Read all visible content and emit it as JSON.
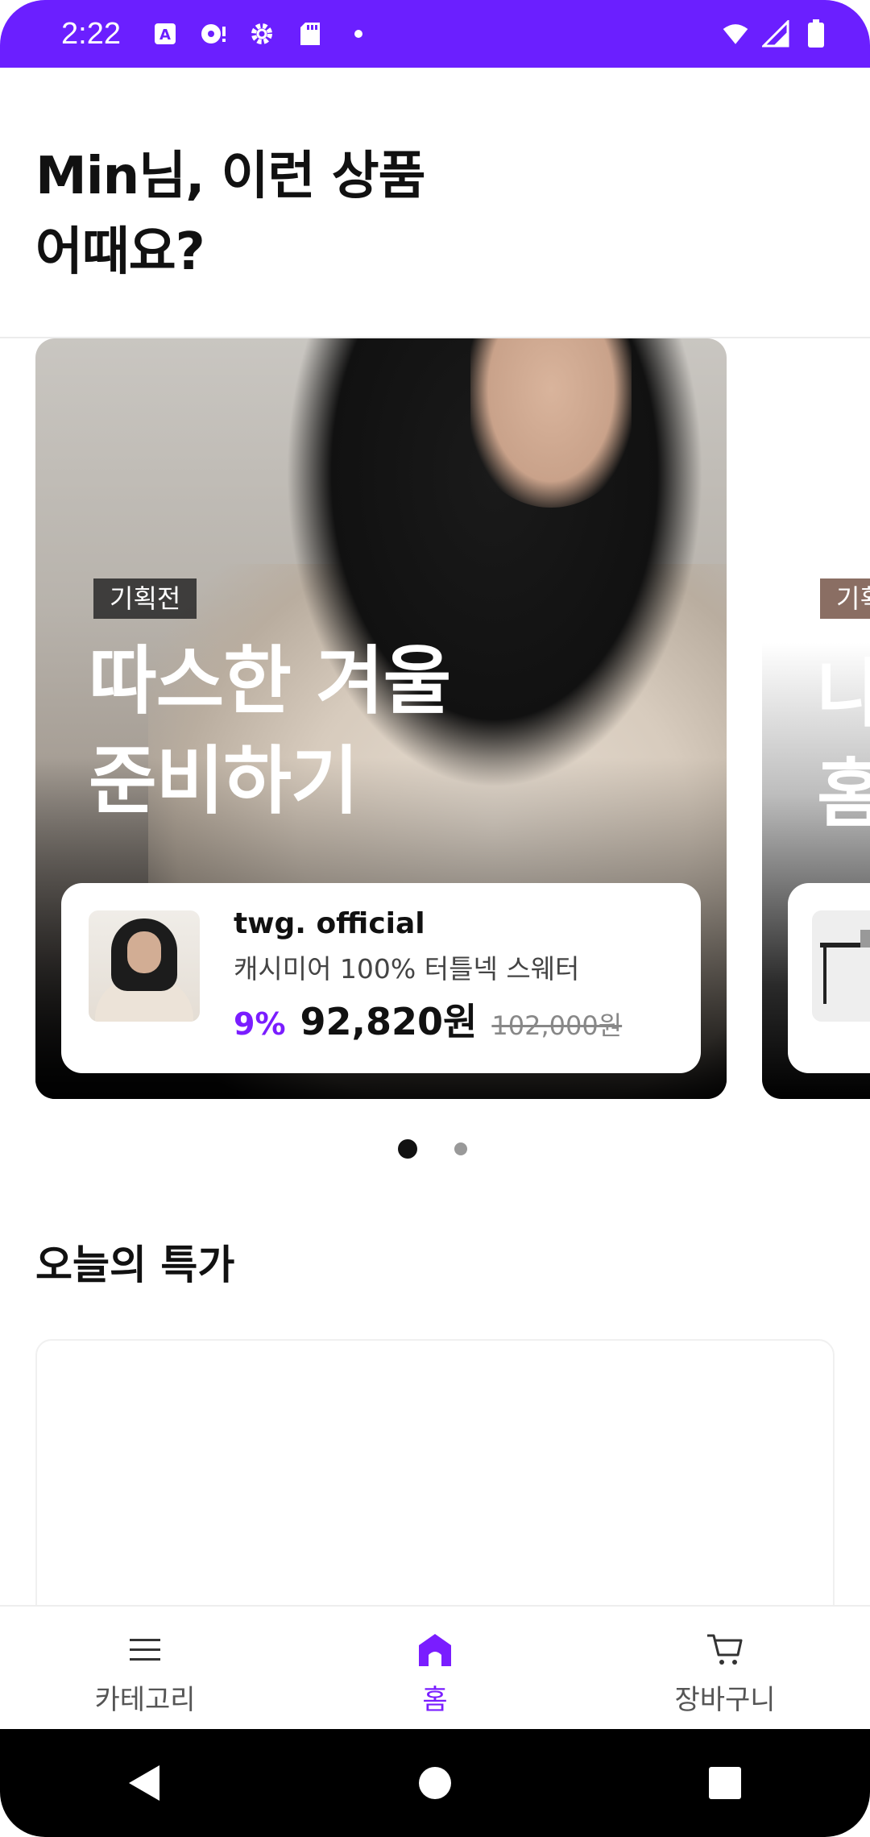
{
  "status_bar": {
    "time": "2:22",
    "icons": [
      "a-icon",
      "media-icon",
      "settings-icon",
      "sd-card-icon",
      "dot-icon"
    ],
    "right_icons": [
      "wifi-icon",
      "signal-icon",
      "battery-icon"
    ],
    "background": "#6b1fff"
  },
  "header": {
    "greeting_line1": "Min님, 이런 상품",
    "greeting_line2": "어때요?"
  },
  "carousel": {
    "cards": [
      {
        "tag": "기획전",
        "title_line1": "따스한 겨울",
        "title_line2": "준비하기",
        "product": {
          "brand": "twg. official",
          "name": "캐시미어 100% 터틀넥 스웨터",
          "discount": "9%",
          "price": "92,820원",
          "original_price": "102,000원"
        }
      },
      {
        "tag": "기획",
        "title_line1": "나",
        "title_line2": "홈"
      }
    ],
    "pages": 2,
    "active_page": 1
  },
  "section": {
    "title": "오늘의 특가"
  },
  "bottom_nav": {
    "items": [
      {
        "label": "카테고리",
        "icon": "menu-icon",
        "active": false
      },
      {
        "label": "홈",
        "icon": "home-icon",
        "active": true
      },
      {
        "label": "장바구니",
        "icon": "cart-icon",
        "active": false
      }
    ],
    "accent": "#7a1dff"
  },
  "system_nav": {
    "icons": [
      "back-icon",
      "home-circle-icon",
      "recents-icon"
    ]
  }
}
